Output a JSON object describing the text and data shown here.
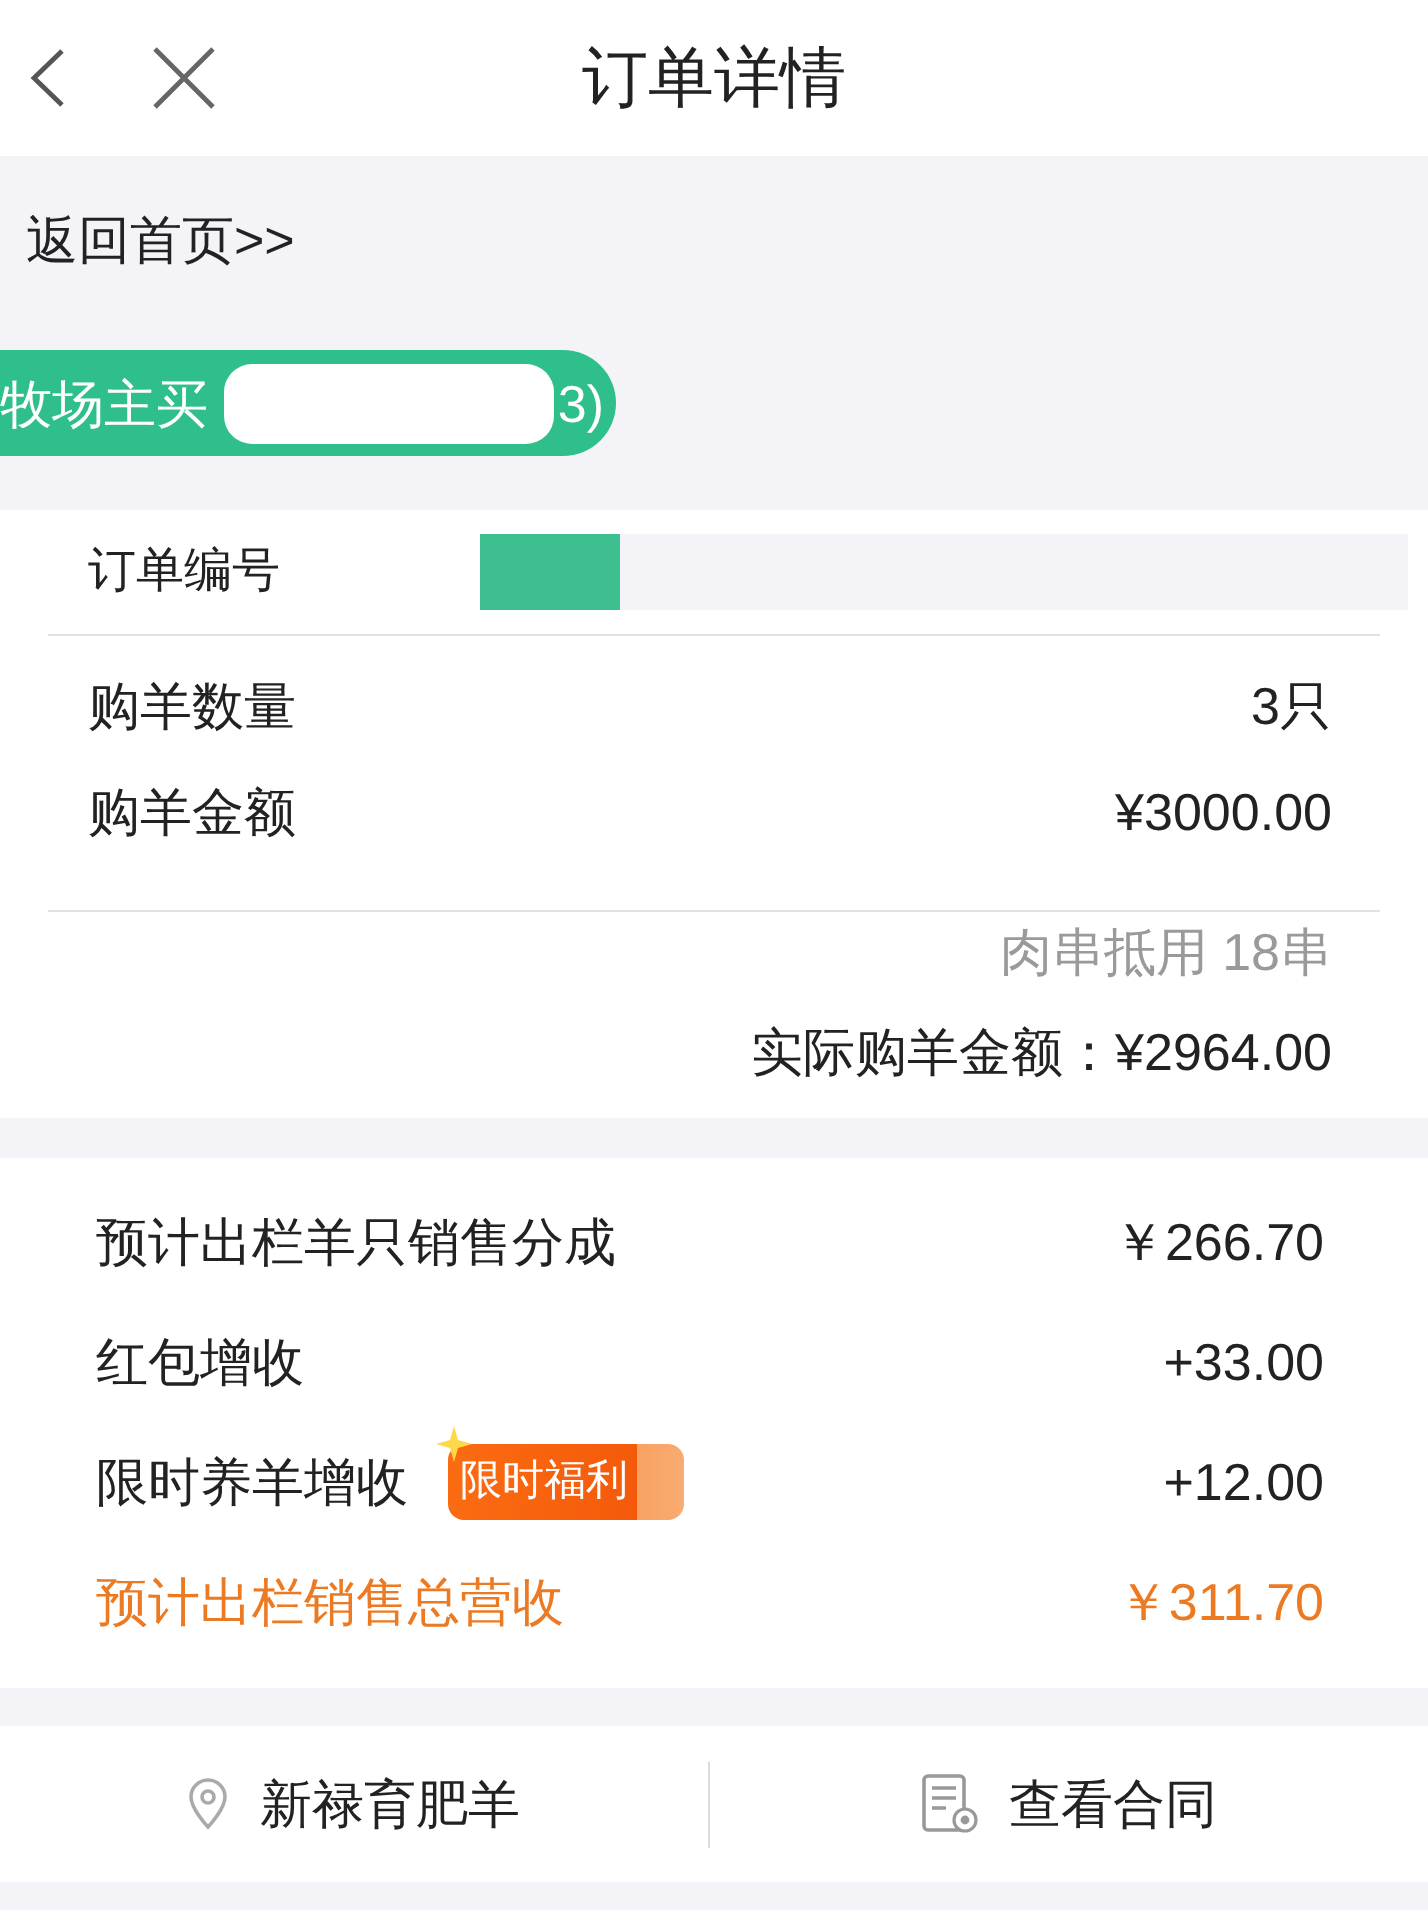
{
  "header": {
    "title": "订单详情"
  },
  "home_link": "返回首页>>",
  "banner": {
    "texts": [
      "牧场主买",
      "3)"
    ]
  },
  "order": {
    "number_label": "订单编号",
    "rows": [
      {
        "label": "购羊数量",
        "value": "3只"
      },
      {
        "label": "购羊金额",
        "value": "¥3000.00"
      }
    ],
    "deduction": "肉串抵用 18串",
    "actual_total": "实际购羊金额：¥2964.00"
  },
  "income": {
    "rows": [
      {
        "kind": "plain",
        "label": "预计出栏羊只销售分成",
        "value": "￥266.70"
      },
      {
        "kind": "plain",
        "label": "红包增收",
        "value": "+33.00"
      },
      {
        "kind": "promo",
        "label": "限时养羊增收",
        "badge": "限时福利",
        "value": "+12.00"
      },
      {
        "kind": "total",
        "label": "预计出栏销售总营收",
        "value": "￥311.70"
      }
    ]
  },
  "actions": [
    {
      "kind": "location",
      "label": "新禄育肥羊"
    },
    {
      "kind": "contract",
      "label": "查看合同"
    }
  ]
}
